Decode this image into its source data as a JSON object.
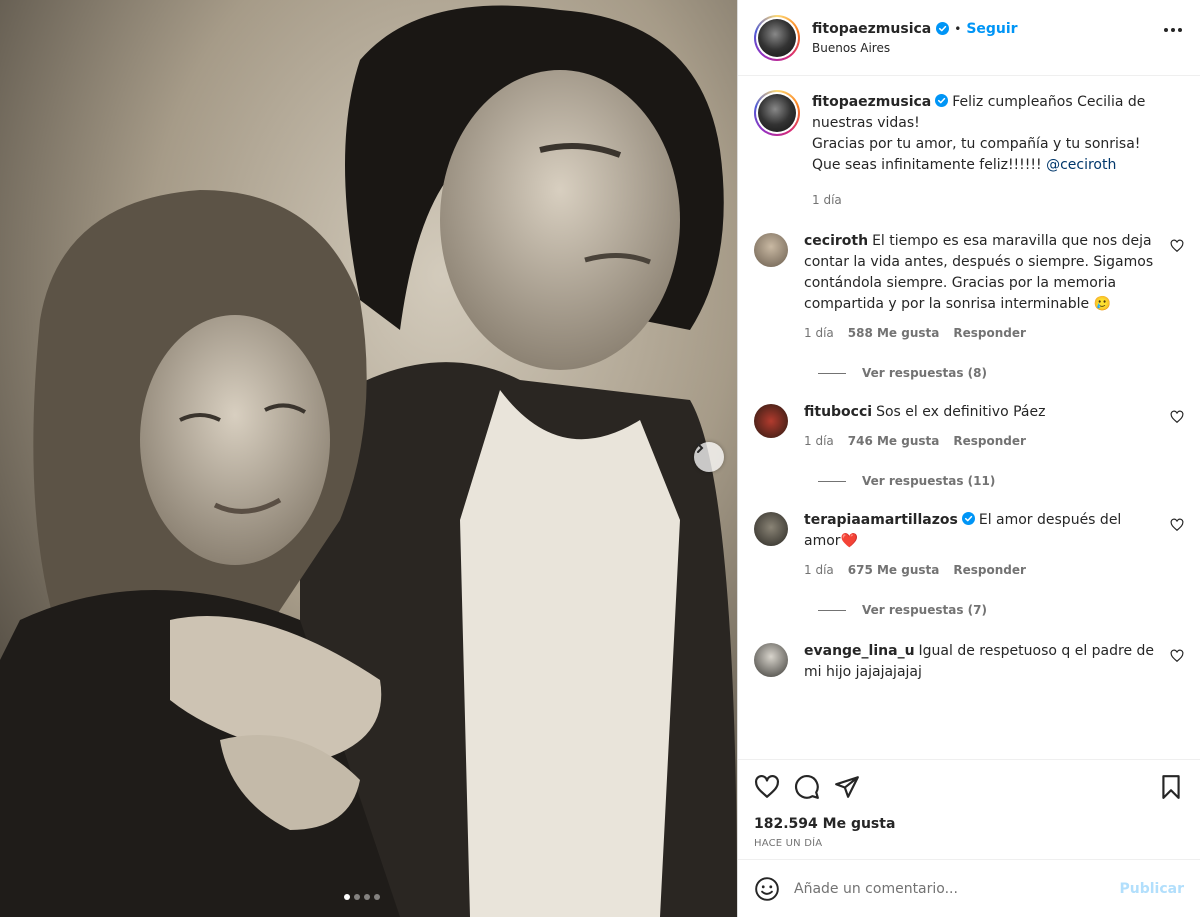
{
  "header": {
    "username": "fitopaezmusica",
    "separator": "•",
    "follow_label": "Seguir",
    "location": "Buenos Aires"
  },
  "caption": {
    "username": "fitopaezmusica",
    "text_1": "Feliz cumpleaños Cecilia de nuestras vidas!",
    "text_2": "Gracias por tu amor, tu compañía y tu sonrisa!",
    "text_3": "Que seas infinitamente feliz!!!!!!",
    "mention": "@ceciroth",
    "time": "1 día"
  },
  "comments": [
    {
      "username": "ceciroth",
      "text": "El tiempo es esa maravilla que nos deja contar la vida antes, después o siempre. Sigamos contándola siempre. Gracias por la memoria compartida y por la sonrisa interminable 🥲",
      "time": "1 día",
      "likes": "588 Me gusta",
      "reply_label": "Responder",
      "view_replies": "Ver respuestas (8)"
    },
    {
      "username": "fitubocci",
      "text": "Sos el ex definitivo Páez",
      "time": "1 día",
      "likes": "746 Me gusta",
      "reply_label": "Responder",
      "view_replies": "Ver respuestas (11)"
    },
    {
      "username": "terapiaamartillazos",
      "text": "El amor después del amor❤️",
      "time": "1 día",
      "likes": "675 Me gusta",
      "reply_label": "Responder",
      "view_replies": "Ver respuestas (7)"
    },
    {
      "username": "evange_lina_u",
      "text": "Igual de respetuoso q el padre de mi hijo jajajajajaj"
    }
  ],
  "actions": {
    "likes_count": "182.594 Me gusta",
    "posted_ago": "HACE UN DÍA"
  },
  "add_comment": {
    "placeholder": "Añade un comentario...",
    "publish_label": "Publicar"
  },
  "colors": {
    "accent": "#0095f6",
    "verified": "#0095f6",
    "heart_emoji": "#e0245e"
  },
  "carousel": {
    "total_slides": 4,
    "active_index": 0
  }
}
